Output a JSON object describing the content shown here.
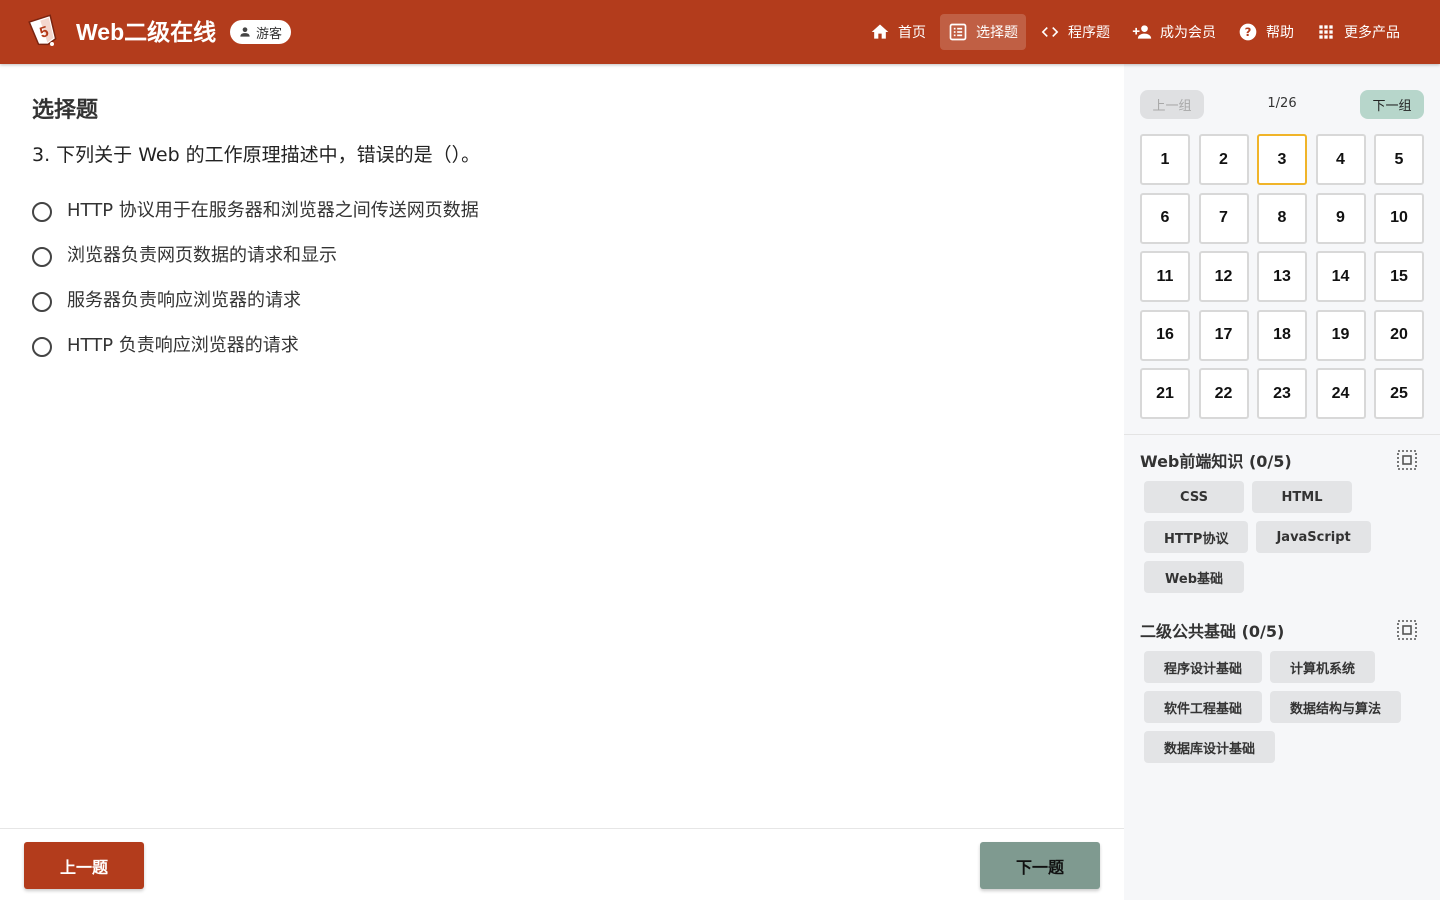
{
  "header": {
    "title": "Web二级在线",
    "guest_label": "游客",
    "nav": [
      {
        "label": "首页",
        "icon": "home-icon"
      },
      {
        "label": "选择题",
        "icon": "list-icon",
        "active": true
      },
      {
        "label": "程序题",
        "icon": "code-icon"
      },
      {
        "label": "成为会员",
        "icon": "person-add-icon"
      },
      {
        "label": "帮助",
        "icon": "help-icon"
      },
      {
        "label": "更多产品",
        "icon": "apps-icon"
      }
    ],
    "colors": {
      "brand": "#b33c1c"
    }
  },
  "main": {
    "section_title": "选择题",
    "question": "3.  下列关于  Web  的工作原理描述中，错误的是（）。",
    "options": [
      "HTTP 协议用于在服务器和浏览器之间传送网页数据",
      "浏览器负责网页数据的请求和显示",
      "服务器负责响应浏览器的请求",
      "HTTP 负责响应浏览器的请求"
    ],
    "prev_label": "上一题",
    "next_label": "下一题"
  },
  "sidebar": {
    "group_prev_label": "上一组",
    "group_count": "1/26",
    "group_next_label": "下一组",
    "questions": [
      "1",
      "2",
      "3",
      "4",
      "5",
      "6",
      "7",
      "8",
      "9",
      "10",
      "11",
      "12",
      "13",
      "14",
      "15",
      "16",
      "17",
      "18",
      "19",
      "20",
      "21",
      "22",
      "23",
      "24",
      "25"
    ],
    "current_question": "3",
    "categories": [
      {
        "title": "Web前端知识 (0/5)",
        "tags": [
          "CSS",
          "HTML",
          "HTTP协议",
          "JavaScript",
          "Web基础"
        ]
      },
      {
        "title": "二级公共基础 (0/5)",
        "tags": [
          "程序设计基础",
          "计算机系统",
          "软件工程基础",
          "数据结构与算法",
          "数据库设计基础"
        ]
      }
    ]
  }
}
